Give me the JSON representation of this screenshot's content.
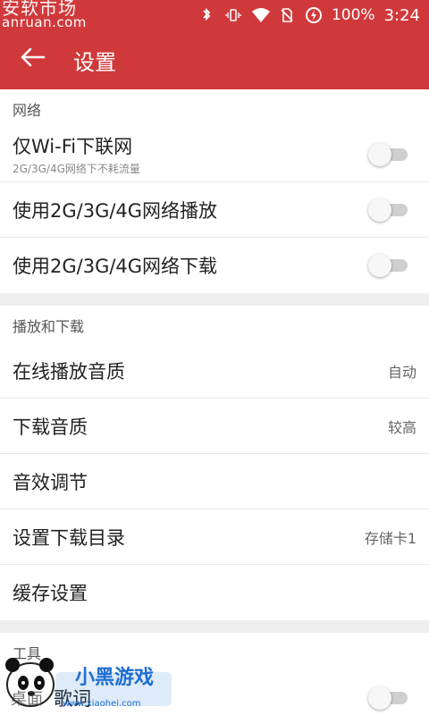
{
  "status_bar": {
    "watermark_line1": "安软市场",
    "watermark_line2": "anruan.com",
    "battery": "100%",
    "time": "3:24"
  },
  "app_bar": {
    "title": "设置"
  },
  "sections": {
    "network": {
      "header": "网络",
      "wifi_only_label": "仅Wi-Fi下联网",
      "wifi_only_sub": "2G/3G/4G网络下不耗流量",
      "mobile_play_label": "使用2G/3G/4G网络播放",
      "mobile_download_label": "使用2G/3G/4G网络下载"
    },
    "playback": {
      "header": "播放和下载",
      "online_quality_label": "在线播放音质",
      "online_quality_value": "自动",
      "download_quality_label": "下载音质",
      "download_quality_value": "较高",
      "eq_label": "音效调节",
      "download_dir_label": "设置下载目录",
      "download_dir_value": "存储卡1",
      "cache_label": "缓存设置"
    },
    "tools": {
      "header": "工具",
      "partial_item_label": "歌词"
    }
  },
  "toggles": {
    "wifi_only": false,
    "mobile_play": false,
    "mobile_download": false,
    "tools_item": false
  },
  "watermark": {
    "text": "小黑游戏",
    "url": "www.xiaohei.com",
    "corner_text": "桌面"
  },
  "colors": {
    "accent": "#d0393b",
    "background": "#eeeeee",
    "toggle_track": "#cfcfcf"
  }
}
